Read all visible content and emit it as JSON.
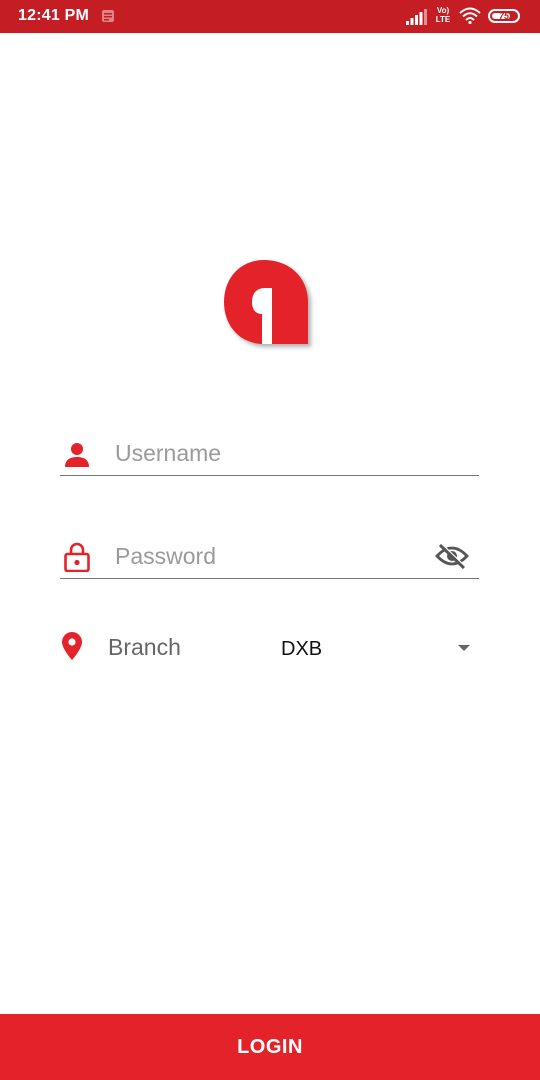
{
  "status_bar": {
    "time": "12:41 PM",
    "network_label_top": "Vo)",
    "network_label_bottom": "LTE",
    "battery_level": 75,
    "battery_text": "75",
    "signal_icon": "signal-icon",
    "wifi_icon": "wifi-icon",
    "notification_icon": "notification-icon"
  },
  "colors": {
    "status_bar": "#c41e24",
    "brand_red": "#e32229",
    "placeholder": "#9a9a9a",
    "underline": "#777777"
  },
  "logo": {
    "icon": "brand-logo-a"
  },
  "form": {
    "username": {
      "placeholder": "Username",
      "value": "",
      "icon": "person-icon"
    },
    "password": {
      "placeholder": "Password",
      "value": "",
      "icon": "lock-icon",
      "toggle_icon": "eye-off-icon"
    },
    "branch": {
      "label": "Branch",
      "selected": "DXB",
      "icon": "location-pin-icon",
      "dropdown_icon": "dropdown-arrow-icon"
    }
  },
  "login_button": {
    "label": "LOGIN"
  }
}
